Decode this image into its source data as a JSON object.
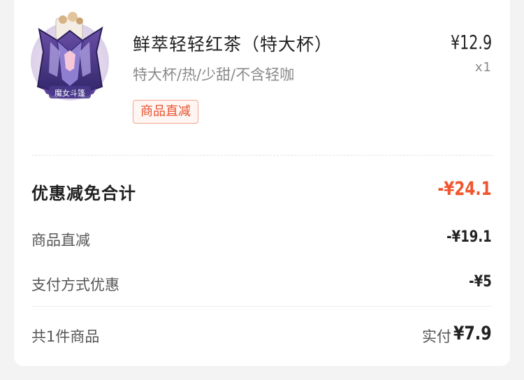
{
  "product": {
    "image_caption": "魔女斗篷",
    "title": "鲜萃轻轻红茶（特大杯）",
    "spec": "特大杯/热/少甜/不含轻咖",
    "tag": "商品直减",
    "price": "¥12.9",
    "quantity": "x1"
  },
  "discount": {
    "total_label": "优惠减免合计",
    "total_value": "-¥24.1",
    "items": [
      {
        "label": "商品直减",
        "value": "-¥19.1"
      },
      {
        "label": "支付方式优惠",
        "value": "-¥5"
      }
    ]
  },
  "summary": {
    "count_label": "共1件商品",
    "paid_label": "实付",
    "paid_value": "¥7.9"
  },
  "colors": {
    "accent": "#f0552e",
    "tag_border": "#f2a48f",
    "background": "#f3f3f3"
  }
}
